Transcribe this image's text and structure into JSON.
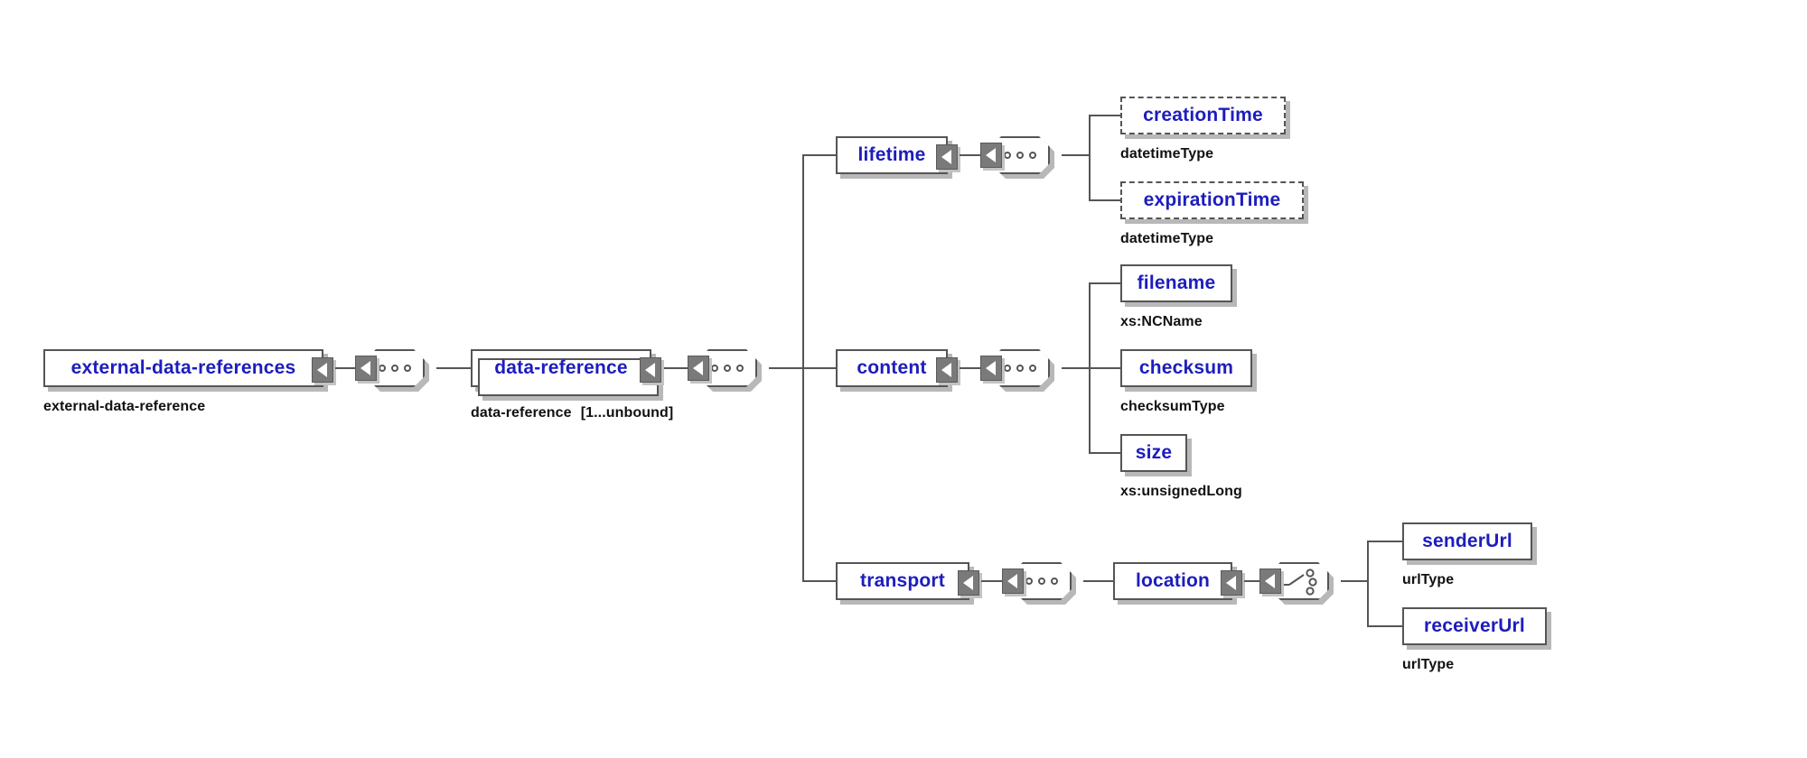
{
  "diagram": {
    "kind": "xsd-schema-tree",
    "background_color": "#ffffff",
    "element_text_color": "#1d1dbe",
    "caption_text_color": "#111111",
    "line_color": "#555555",
    "shadow_color": "#b8b8b8"
  },
  "nodes": {
    "root": {
      "label": "external-data-references",
      "type_caption": "external-data-reference",
      "occurs": ""
    },
    "data_reference": {
      "label": "data-reference",
      "type_caption": "data-reference",
      "occurs": "[1...unbound]"
    },
    "lifetime": {
      "label": "lifetime",
      "type_caption": ""
    },
    "creation_time": {
      "label": "creationTime",
      "type_caption": "datetimeType"
    },
    "expiration_time": {
      "label": "expirationTime",
      "type_caption": "datetimeType"
    },
    "content": {
      "label": "content",
      "type_caption": ""
    },
    "filename": {
      "label": "filename",
      "type_caption": "xs:NCName"
    },
    "checksum": {
      "label": "checksum",
      "type_caption": "checksumType"
    },
    "size": {
      "label": "size",
      "type_caption": "xs:unsignedLong"
    },
    "transport": {
      "label": "transport",
      "type_caption": ""
    },
    "location": {
      "label": "location",
      "type_caption": ""
    },
    "sender_url": {
      "label": "senderUrl",
      "type_caption": "urlType"
    },
    "receiver_url": {
      "label": "receiverUrl",
      "type_caption": "urlType"
    }
  },
  "compositors": {
    "root_sequence": {
      "kind": "sequence"
    },
    "data_reference_sequence": {
      "kind": "sequence"
    },
    "lifetime_sequence": {
      "kind": "sequence"
    },
    "content_sequence": {
      "kind": "sequence"
    },
    "transport_sequence": {
      "kind": "sequence"
    },
    "location_choice": {
      "kind": "choice"
    }
  }
}
